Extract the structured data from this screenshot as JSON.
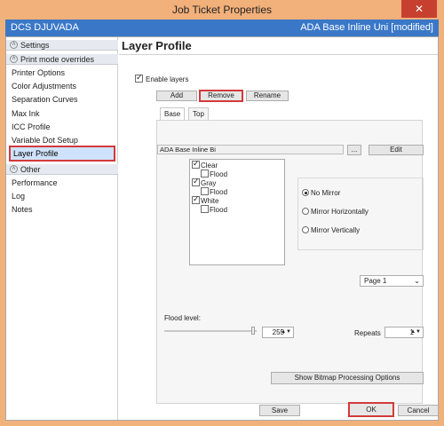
{
  "window": {
    "title": "Job Ticket Properties",
    "close_glyph": "✕"
  },
  "header": {
    "left": "DCS DJUVADA",
    "right": "ADA Base Inline Uni [modified]"
  },
  "sidebar": {
    "sections": [
      {
        "label": "Settings",
        "expanded": true,
        "items": []
      },
      {
        "label": "Print mode overrides",
        "expanded": true,
        "items": [
          "Printer Options",
          "Color Adjustments",
          "Separation Curves",
          "Max Ink",
          "ICC Profile",
          "Variable Dot Setup",
          "Layer Profile"
        ]
      },
      {
        "label": "Other",
        "expanded": true,
        "items": [
          "Performance",
          "Log",
          "Notes"
        ]
      }
    ],
    "selected": "Layer Profile"
  },
  "main": {
    "title": "Layer Profile",
    "enable_layers_label": "Enable layers",
    "enable_layers_checked": true,
    "buttons": {
      "add": "Add",
      "remove": "Remove",
      "rename": "Rename"
    },
    "tabs": [
      "Base",
      "Top"
    ],
    "active_tab": "Base",
    "profile_field": "ADA Base Inline Bi",
    "browse_label": "...",
    "edit_label": "Edit",
    "channels": [
      {
        "label": "Clear",
        "checked": true,
        "indent": false
      },
      {
        "label": "Flood",
        "checked": false,
        "indent": true
      },
      {
        "label": "Gray",
        "checked": true,
        "indent": false
      },
      {
        "label": "Flood",
        "checked": false,
        "indent": true
      },
      {
        "label": "White",
        "checked": true,
        "indent": false
      },
      {
        "label": "Flood",
        "checked": false,
        "indent": true
      }
    ],
    "mirror": {
      "options": [
        "No Mirror",
        "Mirror Horizontally",
        "Mirror Vertically"
      ],
      "selected": "No Mirror"
    },
    "page_select": "Page 1",
    "flood_level_label": "Flood level:",
    "flood_level_value": "255",
    "repeats_label": "Repeats",
    "repeats_value": "1",
    "bitmap_button": "Show Bitmap Processing Options"
  },
  "footer": {
    "save": "Save",
    "ok": "OK",
    "cancel": "Cancel"
  },
  "colors": {
    "accent": "#3a78c7",
    "highlight": "#d23a3a",
    "title_bg": "#f2b07a"
  }
}
